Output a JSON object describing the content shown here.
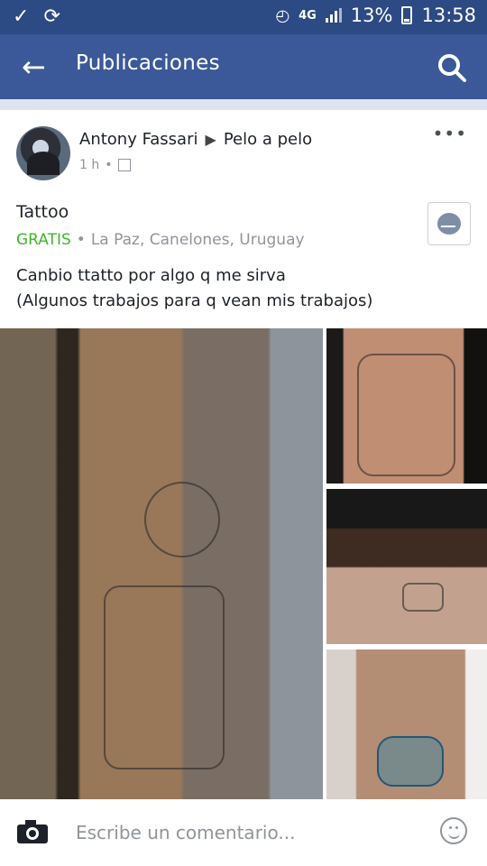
{
  "status_bar": {
    "signal_label": "4G",
    "battery": "13%",
    "time": "13:58"
  },
  "header": {
    "title": "Publicaciones"
  },
  "post": {
    "author": "Antony Fassari",
    "group": "Pelo a pelo",
    "time": "1 h",
    "item_title": "Tattoo",
    "price": "GRATIS",
    "location": "La Paz, Canelones, Uruguay",
    "text_line1": "Canbio ttatto por algo q me sirva",
    "text_line2": "(Algunos trabajos para q vean mis trabajos)"
  },
  "comment": {
    "placeholder": "Escribe un comentario..."
  },
  "icons": [
    "back-icon",
    "search-icon",
    "messenger-icon",
    "camera-icon",
    "smile-icon",
    "more-icon"
  ]
}
